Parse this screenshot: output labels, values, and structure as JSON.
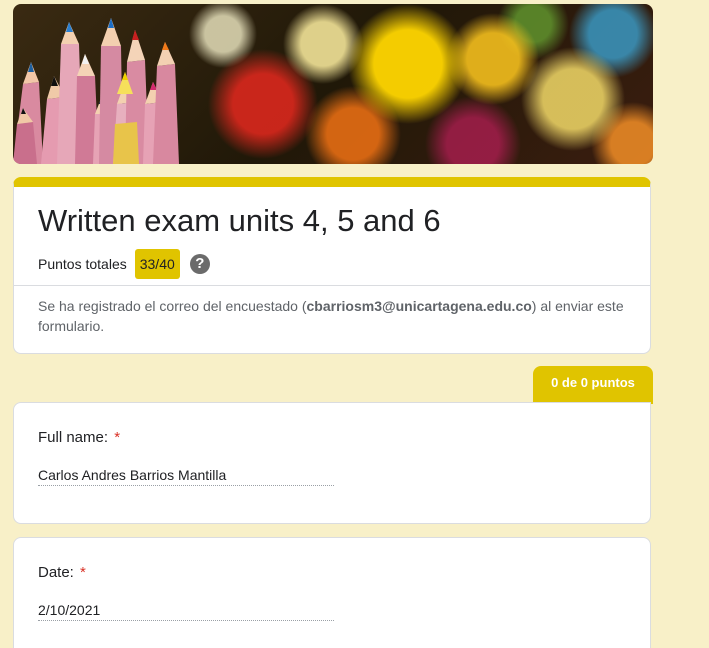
{
  "form": {
    "title": "Written exam units 4, 5 and 6",
    "score_label": "Puntos totales",
    "score_value": "33/40",
    "help_icon": "question-circle-icon",
    "email_note_prefix": "Se ha registrado el correo del encuestado (",
    "email": "cbarriosm3@unicartagena.edu.co",
    "email_note_suffix": ") al enviar este formulario.",
    "accent_color": "#e0c400",
    "background_color": "#f8f0c8"
  },
  "section": {
    "points_label": "0 de 0 puntos"
  },
  "questions": [
    {
      "label": "Full name:",
      "required_mark": "*",
      "answer": "Carlos Andres Barrios Mantilla"
    },
    {
      "label": "Date:",
      "required_mark": "*",
      "answer": "2/10/2021"
    }
  ]
}
